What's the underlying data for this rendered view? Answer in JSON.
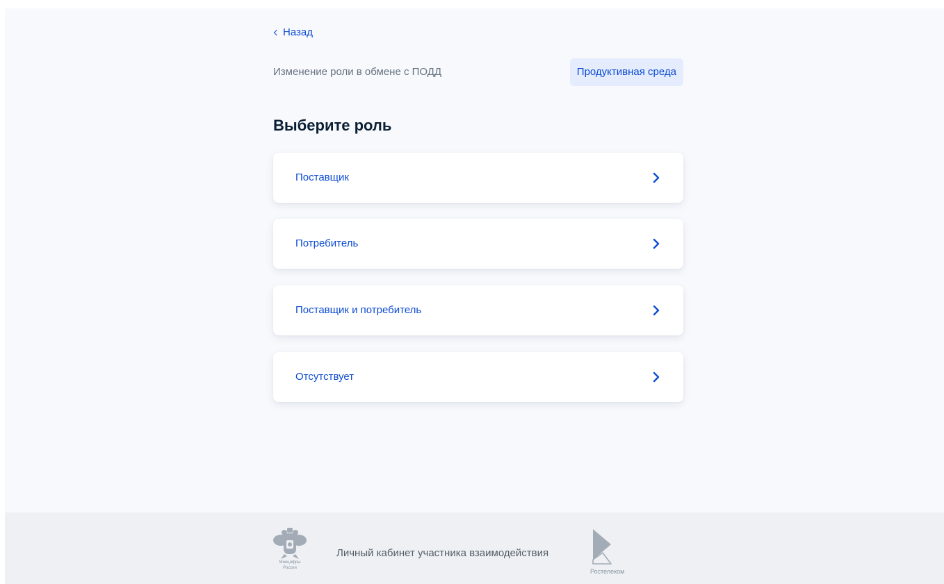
{
  "nav": {
    "back_label": "Назад"
  },
  "header": {
    "subtitle": "Изменение роли в обмене с ПОДД",
    "environment_badge": "Продуктивная среда"
  },
  "main": {
    "title": "Выберите роль",
    "roles": [
      {
        "label": "Поставщик",
        "icon": "chevron-right-icon"
      },
      {
        "label": "Потребитель",
        "icon": "chevron-right-icon"
      },
      {
        "label": "Поставщик и потребитель",
        "icon": "chevron-right-icon"
      },
      {
        "label": "Отсутствует",
        "icon": "chevron-right-icon"
      }
    ]
  },
  "footer": {
    "emblem_caption": "Минцифры России",
    "text": "Личный кабинет участника взаимодействия",
    "partner_caption": "Ростелеком"
  },
  "colors": {
    "accent": "#0d4cd3",
    "page_background": "#f7f9fd",
    "badge_background": "#e4ecfd",
    "footer_background": "#eef0f3",
    "title_text": "#0b1f33",
    "muted_text": "#66727f"
  }
}
